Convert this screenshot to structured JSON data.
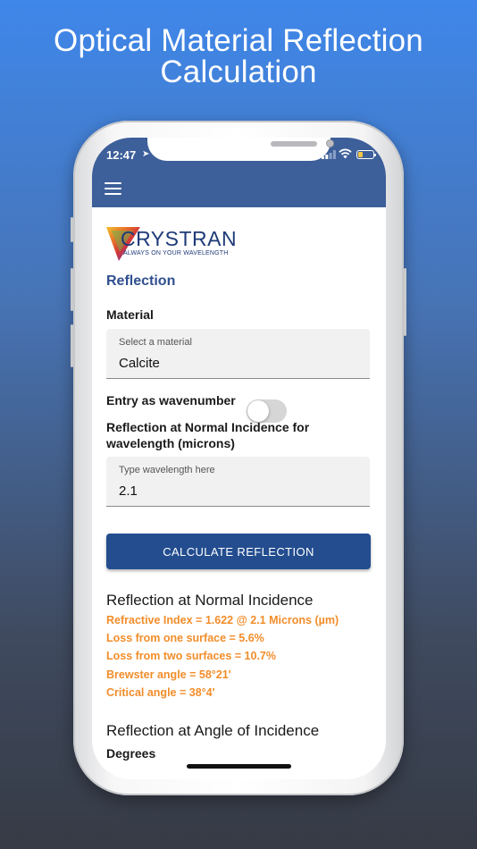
{
  "headline": {
    "line1": "Optical Material Reflection",
    "line2": "Calculation"
  },
  "status_bar": {
    "time": "12:47"
  },
  "logo": {
    "name": "CRYSTRAN",
    "tagline": "ALWAYS ON YOUR WAVELENGTH"
  },
  "section_title": "Reflection",
  "material": {
    "label": "Material",
    "hint": "Select a material",
    "value": "Calcite"
  },
  "wavenumber_toggle": {
    "label": "Entry as wavenumber",
    "on": false
  },
  "wavelength": {
    "label": "Reflection at Normal Incidence for wavelength (microns)",
    "hint": "Type wavelength here",
    "value": "2.1"
  },
  "calculate_button": "CALCULATE REFLECTION",
  "results": {
    "title": "Reflection at Normal Incidence",
    "refractive_index": "Refractive Index = 1.622 @ 2.1 Microns (µm)",
    "loss_one": "Loss from one surface = 5.6%",
    "loss_two": "Loss from two surfaces = 10.7%",
    "brewster": "Brewster angle = 58°21'",
    "critical": "Critical angle = 38°4'"
  },
  "angle_section": {
    "title": "Reflection at Angle of Incidence",
    "degrees_label": "Degrees"
  },
  "colors": {
    "appbar": "#3d5f9a",
    "accent": "#234d8f",
    "result_text": "#f28d2a",
    "section_title": "#2f4f8f"
  }
}
